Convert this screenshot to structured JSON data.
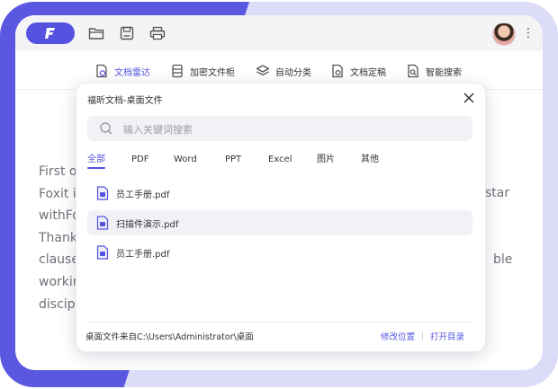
{
  "toolbar": {
    "items": [
      {
        "label": "文档雷达",
        "icon": "radar-doc-icon",
        "active": true
      },
      {
        "label": "加密文件柜",
        "icon": "cabinet-icon",
        "active": false
      },
      {
        "label": "自动分类",
        "icon": "layers-icon",
        "active": false
      },
      {
        "label": "文档定稿",
        "icon": "finalize-doc-icon",
        "active": false
      },
      {
        "label": "智能搜索",
        "icon": "smart-search-icon",
        "active": false
      }
    ]
  },
  "document": {
    "lines": [
      "First o",
      "Foxit i",
      "withFo",
      "Thank",
      "clause",
      "workin",
      "discip"
    ],
    "right_fragments": [
      "star",
      "ble"
    ]
  },
  "popup": {
    "title": "福昕文档-桌面文件",
    "search_placeholder": "输入关键词搜索",
    "tabs": [
      "全部",
      "PDF",
      "Word",
      "PPT",
      "Excel",
      "图片",
      "其他"
    ],
    "active_tab": "全部",
    "files": [
      {
        "name": "员工手册.pdf",
        "selected": false
      },
      {
        "name": "扫描件演示.pdf",
        "selected": true
      },
      {
        "name": "员工手册.pdf",
        "selected": false
      }
    ],
    "footer": {
      "source_path": "桌面文件来自C:\\Users\\Administrator\\桌面",
      "change_location": "修改位置",
      "open_folder": "打开目录"
    }
  },
  "colors": {
    "accent": "#5552e0",
    "frame": "#dcdcf8",
    "text": "#333333"
  }
}
